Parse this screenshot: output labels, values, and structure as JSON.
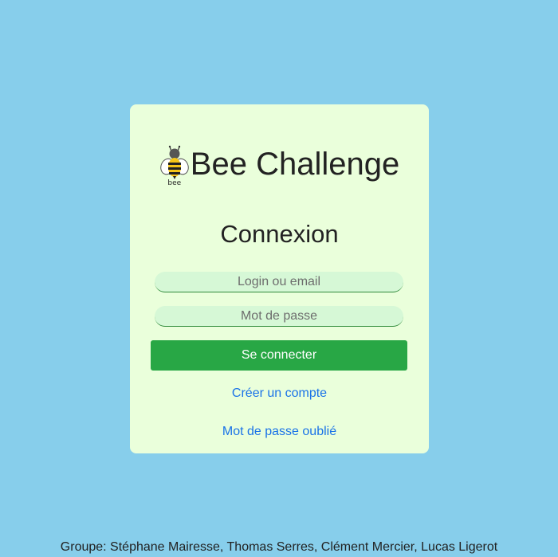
{
  "brand": {
    "title": "Bee Challenge",
    "logo_icon": "bee-icon",
    "logo_text": "bee"
  },
  "form": {
    "heading": "Connexion",
    "login_placeholder": "Login ou email",
    "password_placeholder": "Mot de passe",
    "submit_label": "Se connecter",
    "create_account_label": "Créer un compte",
    "forgot_password_label": "Mot de passe oublié"
  },
  "footer": {
    "text": "Groupe: Stéphane Mairesse, Thomas Serres, Clément Mercier, Lucas Ligerot"
  },
  "colors": {
    "background": "#87ceeb",
    "card": "#eaffdb",
    "input": "#d6f8d6",
    "button": "#28a745",
    "link": "#1a73e8"
  }
}
